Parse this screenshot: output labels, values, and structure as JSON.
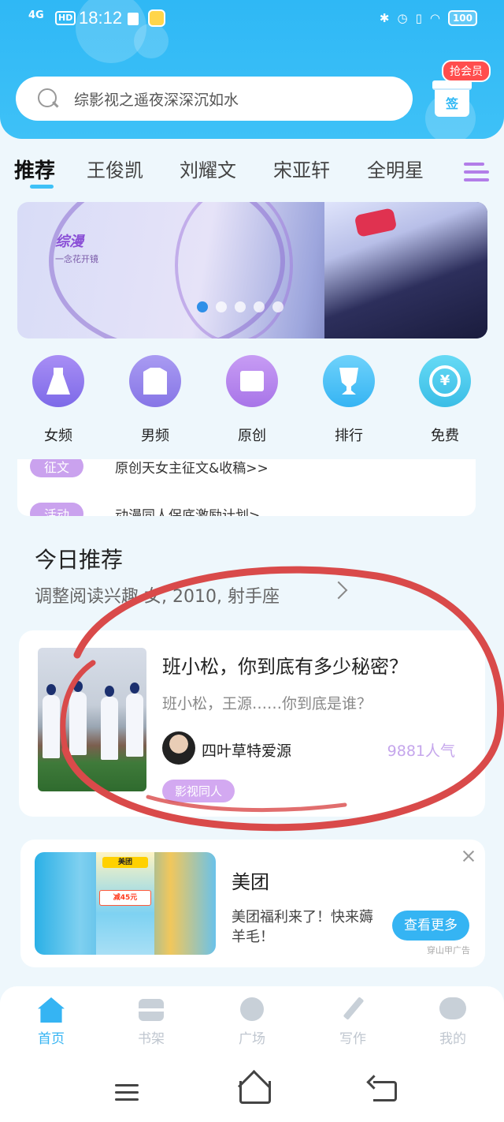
{
  "status_bar": {
    "network": "4G",
    "hd": "HD",
    "time": "18:12",
    "battery": "100"
  },
  "search": {
    "placeholder": "综影视之遥夜深深沉如水"
  },
  "vip": {
    "badge": "抢会员",
    "sign_label": "签"
  },
  "tabs": [
    {
      "label": "推荐",
      "active": true
    },
    {
      "label": "王俊凯",
      "active": false
    },
    {
      "label": "刘耀文",
      "active": false
    },
    {
      "label": "宋亚轩",
      "active": false
    },
    {
      "label": "全明星",
      "active": false
    }
  ],
  "banner": {
    "brand": "综漫",
    "subtitle": "一念花开镜",
    "dot_count": 5,
    "active_dot": 0
  },
  "categories": [
    {
      "label": "女频",
      "icon": "dress-icon",
      "color": "#8f7bee"
    },
    {
      "label": "男频",
      "icon": "shirt-icon",
      "color": "#9585ec"
    },
    {
      "label": "原创",
      "icon": "book-icon",
      "color": "#b685ec"
    },
    {
      "label": "排行",
      "icon": "trophy-icon",
      "color": "#46bcf5"
    },
    {
      "label": "免费",
      "icon": "coin-icon",
      "color": "#48c6ec",
      "symbol": "¥"
    }
  ],
  "notices": [
    {
      "tag": "征文",
      "text": "原创天女主征文&收稿>>"
    },
    {
      "tag": "活动",
      "text": "动漫同人保底激励计划>"
    }
  ],
  "today": {
    "title": "今日推荐",
    "subtitle": "调整阅读兴趣 女, 2010, 射手座"
  },
  "recommend": {
    "title": "班小松，你到底有多少秘密？",
    "desc": "班小松，王源……你到底是谁？",
    "author": "四叶草特爱源",
    "popularity": "9881人气",
    "tag": "影视同人"
  },
  "ad": {
    "title": "美团",
    "desc": "美团福利来了！快来薅羊毛！",
    "button": "查看更多",
    "label": "穿山甲广告",
    "brand_tag": "美团",
    "promo": "减45元"
  },
  "bottom_nav": [
    {
      "label": "首页",
      "icon": "home-icon",
      "active": true
    },
    {
      "label": "书架",
      "icon": "bookshelf-icon",
      "active": false
    },
    {
      "label": "广场",
      "icon": "plaza-icon",
      "active": false
    },
    {
      "label": "写作",
      "icon": "pen-icon",
      "active": false
    },
    {
      "label": "我的",
      "icon": "chat-icon",
      "active": false
    }
  ],
  "colors": {
    "accent": "#35b4f3",
    "annotation": "#d94a4a",
    "tag_purple": "#caa2ee"
  }
}
